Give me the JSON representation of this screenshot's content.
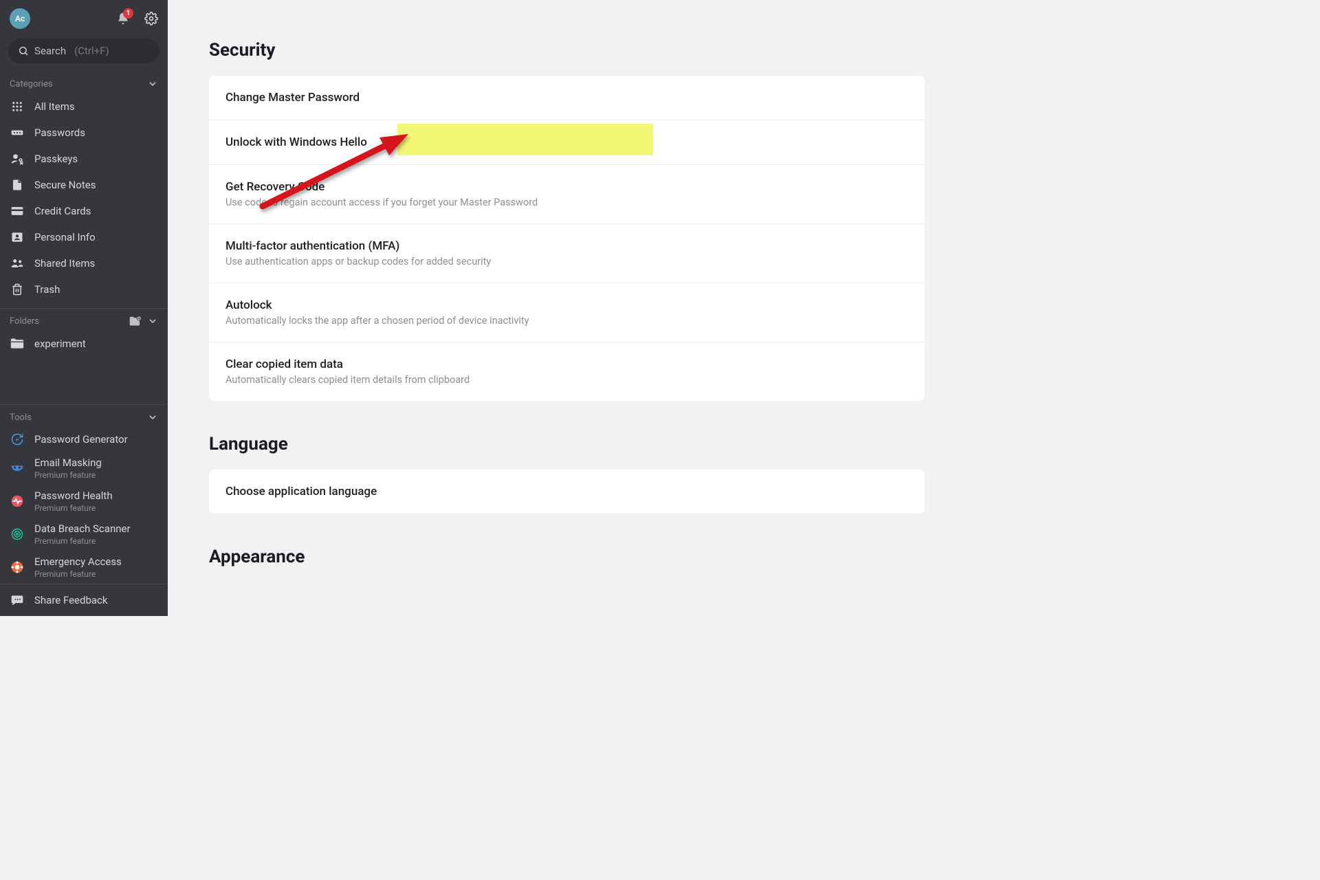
{
  "avatar_initials": "Ac",
  "notifications_count": "1",
  "search": {
    "label": "Search",
    "hint": "(Ctrl+F)"
  },
  "categories_header": "Categories",
  "categories": [
    {
      "label": "All Items"
    },
    {
      "label": "Passwords"
    },
    {
      "label": "Passkeys"
    },
    {
      "label": "Secure Notes"
    },
    {
      "label": "Credit Cards"
    },
    {
      "label": "Personal Info"
    },
    {
      "label": "Shared Items"
    },
    {
      "label": "Trash"
    }
  ],
  "folders_header": "Folders",
  "folders": [
    {
      "label": "experiment"
    }
  ],
  "tools_header": "Tools",
  "premium_label": "Premium feature",
  "tools": [
    {
      "label": "Password Generator",
      "premium": false
    },
    {
      "label": "Email Masking",
      "premium": true
    },
    {
      "label": "Password Health",
      "premium": true
    },
    {
      "label": "Data Breach Scanner",
      "premium": true
    },
    {
      "label": "Emergency Access",
      "premium": true
    }
  ],
  "share_feedback": "Share Feedback",
  "main": {
    "security_title": "Security",
    "security_rows": [
      {
        "title": "Change Master Password",
        "desc": ""
      },
      {
        "title": "Unlock with Windows Hello",
        "desc": ""
      },
      {
        "title": "Get Recovery Code",
        "desc": "Use code to regain account access if you forget your Master Password"
      },
      {
        "title": "Multi-factor authentication (MFA)",
        "desc": "Use authentication apps or backup codes for added security"
      },
      {
        "title": "Autolock",
        "desc": "Automatically locks the app after a chosen period of device inactivity"
      },
      {
        "title": "Clear copied item data",
        "desc": "Automatically clears copied item details from clipboard"
      }
    ],
    "language_title": "Language",
    "language_rows": [
      {
        "title": "Choose application language",
        "desc": ""
      }
    ],
    "appearance_title": "Appearance"
  }
}
